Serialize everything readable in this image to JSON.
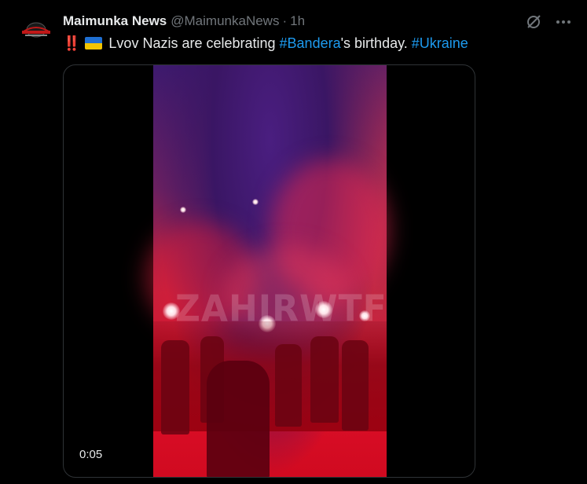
{
  "post": {
    "author_name": "Maimunka News",
    "author_handle": "@MaimunkaNews",
    "separator": "·",
    "timestamp": "1h",
    "text_prefix": "‼️",
    "text_part1": "Lvov Nazis are celebrating ",
    "hashtag1": "#Bandera",
    "text_part2": "'s birthday. ",
    "hashtag2": "#Ukraine",
    "flag_colors": [
      "#1f6fd1",
      "#f2c500"
    ],
    "accent_color": "#1d9bf0",
    "avatar_icon": "maimunka-logo-icon"
  },
  "actions": {
    "grok_icon": "grok-icon",
    "more_icon": "more-horizontal-icon"
  },
  "media": {
    "type": "video",
    "duration": "0:05",
    "watermark": "ZAHIRWTF"
  }
}
